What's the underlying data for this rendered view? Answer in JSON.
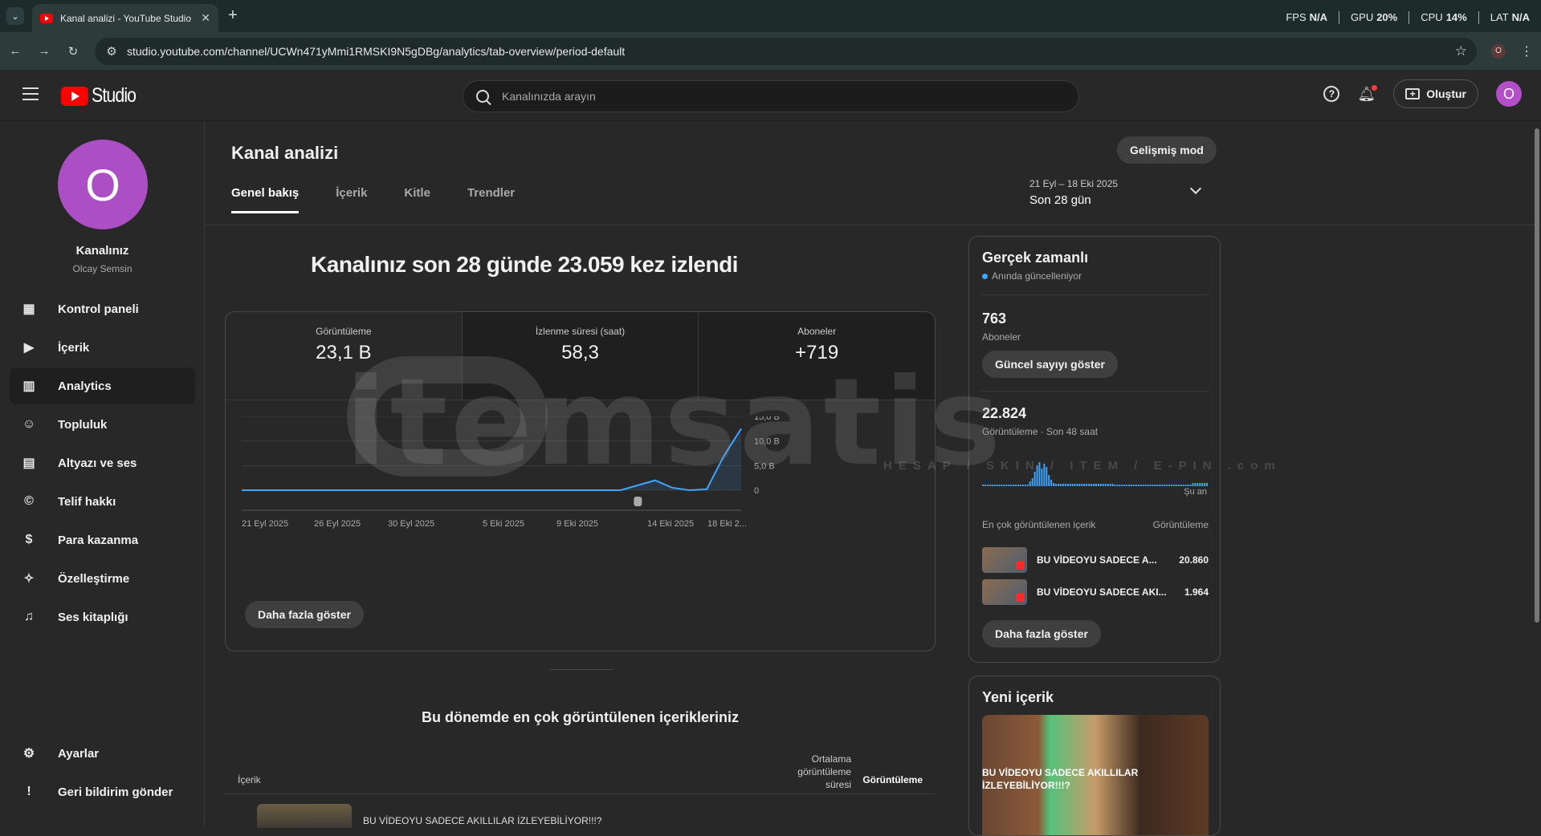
{
  "browser": {
    "tab_title": "Kanal analizi - YouTube Studio",
    "url": "studio.youtube.com/channel/UCWn471yMmi1RMSKI9N5gDBg/analytics/tab-overview/period-default",
    "hud": [
      {
        "label": "FPS",
        "value": "N/A"
      },
      {
        "label": "GPU",
        "value": "20%"
      },
      {
        "label": "CPU",
        "value": "14%"
      },
      {
        "label": "LAT",
        "value": "N/A"
      }
    ],
    "profile_initial": "O"
  },
  "header": {
    "logo_text": "Studio",
    "search_placeholder": "Kanalınızda arayın",
    "create_label": "Oluştur",
    "avatar_initial": "O"
  },
  "sidebar": {
    "channel_avatar_initial": "O",
    "channel_name": "Kanalınız",
    "channel_owner": "Olcay Semsin",
    "items": [
      {
        "label": "Kontrol paneli",
        "icon": "dashboard-icon"
      },
      {
        "label": "İçerik",
        "icon": "content-icon"
      },
      {
        "label": "Analytics",
        "icon": "analytics-icon",
        "active": true
      },
      {
        "label": "Topluluk",
        "icon": "community-icon"
      },
      {
        "label": "Altyazı ve ses",
        "icon": "subtitles-icon"
      },
      {
        "label": "Telif hakkı",
        "icon": "copyright-icon"
      },
      {
        "label": "Para kazanma",
        "icon": "dollar-icon"
      },
      {
        "label": "Özelleştirme",
        "icon": "magic-wand-icon"
      },
      {
        "label": "Ses kitaplığı",
        "icon": "audio-library-icon"
      }
    ],
    "bottom_items": [
      {
        "label": "Ayarlar",
        "icon": "gear-icon"
      },
      {
        "label": "Geri bildirim gönder",
        "icon": "feedback-icon"
      }
    ]
  },
  "main": {
    "page_title": "Kanal analizi",
    "advanced_mode": "Gelişmiş mod",
    "tabs": [
      "Genel bakış",
      "İçerik",
      "Kitle",
      "Trendler"
    ],
    "date_range": "21 Eyl – 18 Eki 2025",
    "date_period": "Son 28 gün",
    "headline": "Kanalınız son 28 günde 23.059 kez izlendi",
    "metrics": [
      {
        "label": "Görüntüleme",
        "value": "23,1 B"
      },
      {
        "label": "İzlenme süresi (saat)",
        "value": "58,3"
      },
      {
        "label": "Aboneler",
        "value": "+719"
      }
    ],
    "more_button": "Daha fazla göster",
    "top_content_title": "Bu dönemde en çok görüntülenen içerikleriniz",
    "table_headers": {
      "content": "İçerik",
      "avg_line1": "Ortalama",
      "avg_line2": "görüntüleme",
      "avg_line3": "süresi",
      "views": "Görüntüleme"
    },
    "table_rows": [
      {
        "title": "BU VİDEOYU SADECE AKILLILAR İZLEYEBİLİYOR!!!?"
      }
    ]
  },
  "chart_data": {
    "type": "area",
    "x": [
      "21 Eyl 2025",
      "26 Eyl 2025",
      "30 Eyl 2025",
      "5 Eki 2025",
      "9 Eki 2025",
      "14 Eki 2025",
      "18 Eki 2025"
    ],
    "x_tick_labels": [
      "21 Eyl 2025",
      "26 Eyl 2025",
      "30 Eyl 2025",
      "5 Eki 2025",
      "9 Eki 2025",
      "14 Eki 2025",
      "18 Eki 2..."
    ],
    "y_tick_labels": [
      "15,0 B",
      "10,0 B",
      "5,0 B",
      "0"
    ],
    "ylim": [
      0,
      15000
    ],
    "series": [
      {
        "values": [
          0,
          0,
          0,
          0,
          0,
          0,
          0,
          0,
          0,
          0,
          0,
          0,
          0,
          0,
          0,
          0,
          0,
          0,
          0,
          0,
          0,
          0,
          0,
          1000,
          2000,
          500,
          0,
          200,
          7000,
          12500
        ]
      }
    ]
  },
  "realtime": {
    "title": "Gerçek zamanlı",
    "live_text": "Anında güncelleniyor",
    "subs_value": "763",
    "subs_label": "Aboneler",
    "show_count_button": "Güncel sayıyı göster",
    "views_value": "22.824",
    "views_label": "Görüntüleme · Son 48 saat",
    "now_label": "Şu an",
    "list_header_left": "En çok görüntülenen içerik",
    "list_header_right": "Görüntüleme",
    "items": [
      {
        "title": "BU VİDEOYU SADECE A...",
        "value": "20.860"
      },
      {
        "title": "BU VİDEOYU SADECE AKI...",
        "value": "1.964"
      }
    ],
    "more_button": "Daha fazla göster"
  },
  "new_content": {
    "title": "Yeni içerik",
    "caption": "BU VİDEOYU SADECE AKILLILAR İZLEYEBİLİYOR!!!?"
  },
  "watermark": {
    "text": "itemsatis",
    "sub": "HESAP / SKIN / ITEM / E-PIN .com"
  }
}
